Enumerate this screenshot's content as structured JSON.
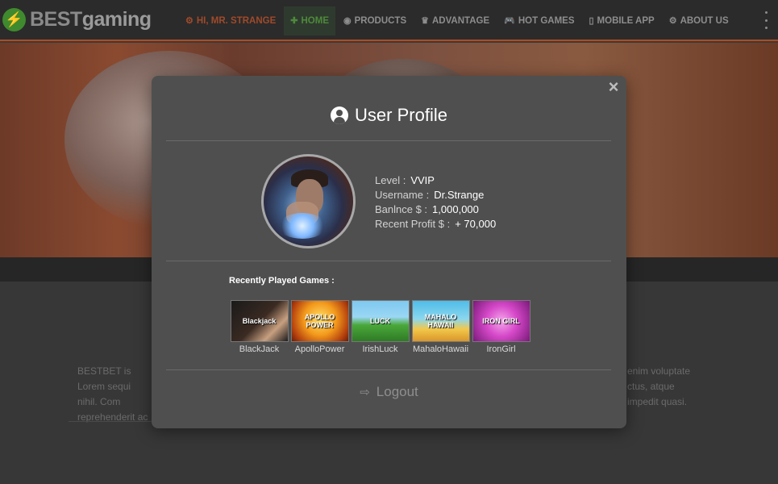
{
  "brand": {
    "logo_symbol": "⚡",
    "name_part1": "BEST",
    "name_part2": "gaming"
  },
  "nav": {
    "items": [
      {
        "icon": "⚙",
        "label": "Hi, Mr. Strange",
        "name": "user"
      },
      {
        "icon": "✚",
        "label": "Home",
        "name": "home"
      },
      {
        "icon": "◉",
        "label": "Products",
        "name": "products"
      },
      {
        "icon": "♛",
        "label": "Advantage",
        "name": "advantage"
      },
      {
        "icon": "🎮",
        "label": "Hot Games",
        "name": "hot-games"
      },
      {
        "icon": "▯",
        "label": "Mobile App",
        "name": "mobile-app"
      },
      {
        "icon": "⚙",
        "label": "About Us",
        "name": "about-us"
      }
    ],
    "active": "home"
  },
  "background_text": {
    "left": "BESTBET is Lorem sequi nihil. Com reprehenderit ac",
    "right": "enim voluptate ctus, atque impedit quasi."
  },
  "modal": {
    "close": "×",
    "title": "User Profile",
    "profile": {
      "level_label": "Level :",
      "level_value": "VVIP",
      "username_label": "Username :",
      "username_value": "Dr.Strange",
      "balance_label": "Banlnce $ :",
      "balance_value": "1,000,000",
      "profit_label": "Recent Profit $ :",
      "profit_value": "+ 70,000"
    },
    "recent_label": "Recently Played Games :",
    "games": [
      {
        "name": "BlackJack",
        "thumb_text": "Blackjack"
      },
      {
        "name": "ApolloPower",
        "thumb_text": "APOLLO POWER"
      },
      {
        "name": "IrishLuck",
        "thumb_text": "LUCK"
      },
      {
        "name": "MahaloHawaii",
        "thumb_text": "MAHALO HAWAII"
      },
      {
        "name": "IronGirl",
        "thumb_text": "IRON GIRL"
      }
    ],
    "logout_icon": "⇨",
    "logout_label": "Logout"
  },
  "colors": {
    "accent_border": "#b34a1e",
    "active_nav": "#4d8a3a",
    "modal_bg": "#4f4f4f"
  }
}
